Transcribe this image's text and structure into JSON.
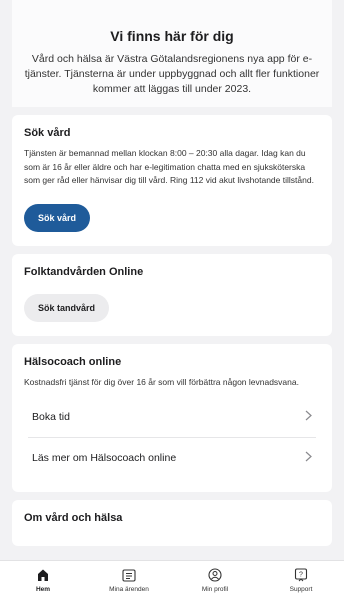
{
  "hero": {
    "title": "Vi finns här för dig",
    "text": "Vård och hälsa är Västra Götalandsregionens nya app för e-tjänster. Tjänsterna är under uppbyggnad och allt fler funktioner kommer att läggas till under 2023."
  },
  "sok_vard": {
    "title": "Sök vård",
    "text": "Tjänsten är bemannad mellan klockan 8:00 – 20:30 alla dagar. Idag kan du som är 16 år eller äldre och har e-legitimation chatta med en sjuksköterska som ger råd eller hänvisar dig till vård. Ring 112 vid akut livshotande tillstånd.",
    "button": "Sök vård"
  },
  "folktandvarden": {
    "title": "Folktandvården Online",
    "button": "Sök tandvård"
  },
  "halsocoach": {
    "title": "Hälsocoach online",
    "text": "Kostnadsfri tjänst för dig över 16 år som vill förbättra någon levnadsvana.",
    "items": [
      {
        "label": "Boka tid"
      },
      {
        "label": "Läs mer om Hälsocoach online"
      }
    ]
  },
  "om_vard": {
    "title": "Om vård och hälsa"
  },
  "tabbar": {
    "items": [
      {
        "label": "Hem",
        "icon": "home-icon"
      },
      {
        "label": "Mina ärenden",
        "icon": "inbox-icon"
      },
      {
        "label": "Min profil",
        "icon": "profile-icon"
      },
      {
        "label": "Support",
        "icon": "support-icon"
      }
    ]
  },
  "colors": {
    "primary": "#1f5b9a",
    "background": "#f2f2f4"
  }
}
